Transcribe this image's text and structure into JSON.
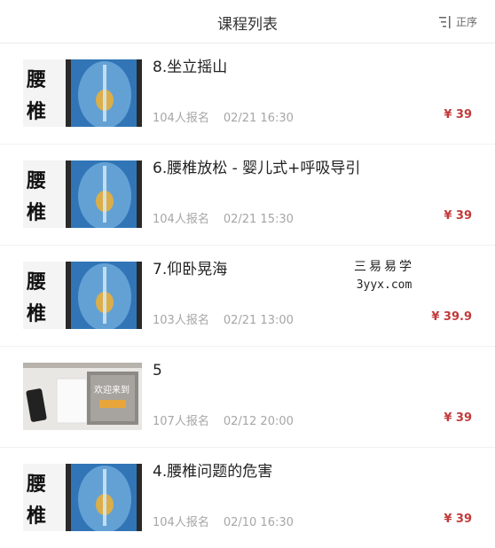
{
  "header": {
    "title": "课程列表",
    "sort_label": "正序",
    "sort_icon": "sort-list-icon"
  },
  "colors": {
    "price": "#c33a3a",
    "meta": "#a6a6a6",
    "thumb_blue": "#1d5fa5",
    "thumb_glow": "#f0b030"
  },
  "courses": [
    {
      "title": "8.坐立摇山",
      "enrolled": "104人报名",
      "date": "02/21 16:30",
      "price": "¥ 39",
      "thumb_chars": [
        "腰",
        "椎"
      ],
      "thumb_type": "spine"
    },
    {
      "title": "6.腰椎放松 - 婴儿式+呼吸导引",
      "enrolled": "104人报名",
      "date": "02/21 15:30",
      "price": "¥ 39",
      "thumb_chars": [
        "腰",
        "椎"
      ],
      "thumb_type": "spine"
    },
    {
      "title": "7.仰卧晃海",
      "enrolled": "103人报名",
      "date": "02/21 13:00",
      "price": "¥ 39.9",
      "thumb_chars": [
        "腰",
        "椎"
      ],
      "thumb_type": "spine"
    },
    {
      "title": "5",
      "enrolled": "107人报名",
      "date": "02/12 20:00",
      "price": "¥ 39",
      "thumb_caption": "欢迎来到",
      "thumb_type": "desk"
    },
    {
      "title": "4.腰椎问题的危害",
      "enrolled": "104人报名",
      "date": "02/10 16:30",
      "price": "¥ 39",
      "thumb_chars": [
        "腰",
        "椎"
      ],
      "thumb_type": "spine"
    }
  ],
  "watermark": {
    "cn": "三易易学",
    "en": "3yyx.com"
  }
}
